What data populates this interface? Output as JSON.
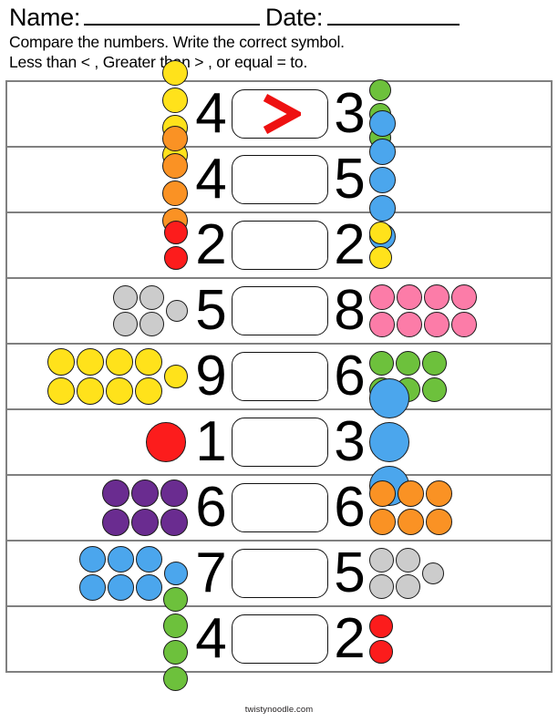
{
  "header": {
    "name_label": "Name:",
    "date_label": "Date:",
    "instruction_line_1": "Compare the numbers. Write the correct symbol.",
    "instruction_line_2": "Less than < , Greater than > , or equal  = to."
  },
  "footer": {
    "site": "twistynoodle.com"
  },
  "palette": {
    "yellow": "#FFE21B",
    "orange": "#FA9224",
    "red": "#FC1C1C",
    "gray": "#CCCCCC",
    "pink": "#FC7CA8",
    "green": "#6DC13C",
    "blue": "#4BA6ED",
    "purple": "#6A2C90",
    "symbol_red": "#EE1111",
    "border_gray": "#808080",
    "dot_outline": "#1A1A1A"
  },
  "answer_symbol_filled": ">",
  "rows": [
    {
      "index": 1,
      "left_count": 4,
      "left_number": "4",
      "left_color": "#FFE21B",
      "left_color_name": "yellow",
      "left_layout": "1x4",
      "left_dot_size": 28,
      "answer": ">",
      "answer_filled": true,
      "right_count": 3,
      "right_number": "3",
      "right_color": "#6DC13C",
      "right_color_name": "green",
      "right_layout": "1x3",
      "right_dot_size": 24
    },
    {
      "index": 2,
      "left_count": 4,
      "left_number": "4",
      "left_color": "#FA9224",
      "left_color_name": "orange",
      "left_layout": "1x4",
      "left_dot_size": 28,
      "answer": "",
      "answer_filled": false,
      "right_count": 5,
      "right_number": "5",
      "right_color": "#4BA6ED",
      "right_color_name": "blue",
      "right_layout": "1x5",
      "right_dot_size": 29
    },
    {
      "index": 3,
      "left_count": 2,
      "left_number": "2",
      "left_color": "#FC1C1C",
      "left_color_name": "red",
      "left_layout": "1x2",
      "left_dot_size": 26,
      "answer": "",
      "answer_filled": false,
      "right_count": 2,
      "right_number": "2",
      "right_color": "#FFE21B",
      "right_color_name": "yellow",
      "right_layout": "1x2",
      "right_dot_size": 25
    },
    {
      "index": 4,
      "left_count": 5,
      "left_number": "5",
      "left_color": "#CCCCCC",
      "left_color_name": "gray",
      "left_layout": "2x2+1",
      "left_dot_size": 27,
      "answer": "",
      "answer_filled": false,
      "right_count": 8,
      "right_number": "8",
      "right_color": "#FC7CA8",
      "right_color_name": "pink",
      "right_layout": "4x2",
      "right_dot_size": 28
    },
    {
      "index": 5,
      "left_count": 9,
      "left_number": "9",
      "left_color": "#FFE21B",
      "left_color_name": "yellow",
      "left_layout": "4x2+1",
      "left_dot_size": 30,
      "answer": "",
      "answer_filled": false,
      "right_count": 6,
      "right_number": "6",
      "right_color": "#6DC13C",
      "right_color_name": "green",
      "right_layout": "3x2",
      "right_dot_size": 27
    },
    {
      "index": 6,
      "left_count": 1,
      "left_number": "1",
      "left_color": "#FC1C1C",
      "left_color_name": "red",
      "left_layout": "1x1",
      "left_dot_size": 44,
      "answer": "",
      "answer_filled": false,
      "right_count": 3,
      "right_number": "3",
      "right_color": "#4BA6ED",
      "right_color_name": "blue",
      "right_layout": "1x3",
      "right_dot_size": 44
    },
    {
      "index": 7,
      "left_count": 6,
      "left_number": "6",
      "left_color": "#6A2C90",
      "left_color_name": "purple",
      "left_layout": "3x2",
      "left_dot_size": 30,
      "answer": "",
      "answer_filled": false,
      "right_count": 6,
      "right_number": "6",
      "right_color": "#FA9224",
      "right_color_name": "orange",
      "right_layout": "3x2",
      "right_dot_size": 29
    },
    {
      "index": 8,
      "left_count": 7,
      "left_number": "7",
      "left_color": "#4BA6ED",
      "left_color_name": "blue",
      "left_layout": "3x2+1",
      "left_dot_size": 29,
      "answer": "",
      "answer_filled": false,
      "right_count": 5,
      "right_number": "5",
      "right_color": "#CCCCCC",
      "right_color_name": "gray",
      "right_layout": "2x2+1",
      "right_dot_size": 27
    },
    {
      "index": 9,
      "left_count": 4,
      "left_number": "4",
      "left_color": "#6DC13C",
      "left_color_name": "green",
      "left_layout": "1x4",
      "left_dot_size": 27,
      "answer": "",
      "answer_filled": false,
      "right_count": 2,
      "right_number": "2",
      "right_color": "#FC1C1C",
      "right_color_name": "red",
      "right_layout": "1x2",
      "right_dot_size": 26
    }
  ]
}
